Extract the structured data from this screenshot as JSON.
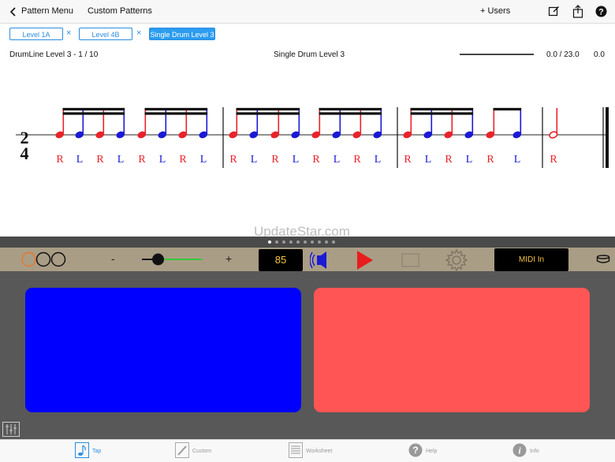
{
  "nav": {
    "back_label": "Pattern Menu",
    "custom_patterns_label": "Custom Patterns",
    "users_label": "+ Users"
  },
  "pattern_tabs": [
    {
      "label": "Level 1A",
      "active": false
    },
    {
      "label": "Level 4B",
      "active": false
    },
    {
      "label": "Single Drum Level 3",
      "active": true
    }
  ],
  "close_glyph": "×",
  "info": {
    "level": "DrumLine Level 3 - 1 / 10",
    "pattern_name": "Single Drum Level 3",
    "progress_readout": "0.0 / 23.0",
    "score": "0.0",
    "progress_fraction": 0.0
  },
  "score": {
    "time_signature": {
      "top": "2",
      "bottom": "4"
    },
    "measures": [
      {
        "sticking": [
          "R",
          "L",
          "R",
          "L",
          "R",
          "L",
          "R",
          "L"
        ]
      },
      {
        "sticking": [
          "R",
          "L",
          "R",
          "L",
          "R",
          "L",
          "R",
          "L"
        ]
      },
      {
        "sticking": [
          "R",
          "L",
          "R",
          "L",
          "R",
          "L"
        ]
      },
      {
        "sticking": [
          "R"
        ]
      }
    ],
    "colors": {
      "right": "#e8232a",
      "left": "#1a1ad4",
      "staff": "#222222"
    }
  },
  "watermark": "UpdateStar.com",
  "controls": {
    "minus_label": "-",
    "plus_label": "+",
    "tempo_value": "85",
    "tempo_slider_fraction": 0.27,
    "midi_label": "MIDI In",
    "page_dots_count": 10,
    "page_dots_active": 0,
    "colors": {
      "accent": "#f5c542",
      "play": "#e81c1c",
      "slider": "#36c63a"
    }
  },
  "pads": {
    "left_color": "#0000ff",
    "right_color": "#ff5555"
  },
  "tabbar": {
    "items": [
      {
        "label": "Tap",
        "icon": "note-icon",
        "active": true
      },
      {
        "label": "Custom",
        "icon": "pencil-icon",
        "active": false
      },
      {
        "label": "Worksheet",
        "icon": "worksheet-icon",
        "active": false
      },
      {
        "label": "Help",
        "icon": "help-icon",
        "active": false
      },
      {
        "label": "Info",
        "icon": "info-icon",
        "active": false
      }
    ]
  }
}
